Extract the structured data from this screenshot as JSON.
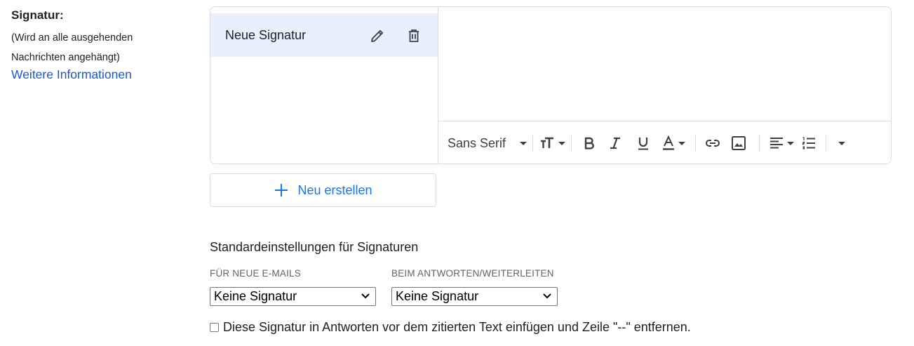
{
  "signature_section": {
    "title": "Signatur:",
    "hint_line1": "(Wird an alle ausgehenden",
    "hint_line2": "Nachrichten angehängt)",
    "more_info_link": "Weitere Informationen"
  },
  "signatures": {
    "items": [
      {
        "name": "Neue Signatur"
      }
    ],
    "new_button_label": "Neu erstellen"
  },
  "editor_toolbar": {
    "font": "Sans Serif",
    "icons": [
      "font-size-icon",
      "bold-icon",
      "italic-icon",
      "underline-icon",
      "text-color-icon",
      "link-icon",
      "image-icon",
      "align-icon",
      "numbered-list-icon",
      "more-icon"
    ]
  },
  "defaults": {
    "title": "Standardeinstellungen für Signaturen",
    "new_mail_label": "FÜR NEUE E-MAILS",
    "new_mail_value": "Keine Signatur",
    "reply_label": "BEIM ANTWORTEN/WEITERLEITEN",
    "reply_value": "Keine Signatur",
    "checkbox_label": "Diese Signatur in Antworten vor dem zitierten Text einfügen und Zeile \"--\" entfernen.",
    "checkbox_checked": false
  },
  "colors": {
    "link": "#1a57c9",
    "accent": "#1a73e8",
    "selected_bg": "#e8f0fe",
    "border": "#dadce0"
  }
}
